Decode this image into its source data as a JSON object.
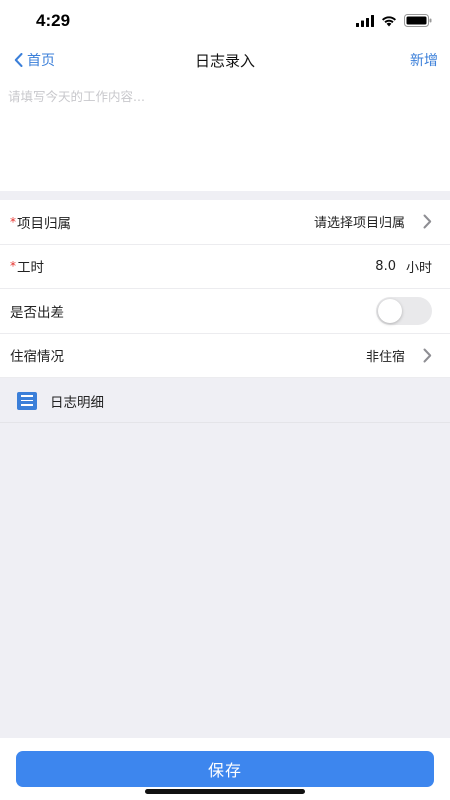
{
  "status_bar": {
    "time": "4:29"
  },
  "nav": {
    "back_label": "首页",
    "title": "日志录入",
    "action_label": "新增"
  },
  "content": {
    "placeholder": "请填写今天的工作内容...",
    "value": ""
  },
  "form": {
    "project": {
      "label": "项目归属",
      "value": "请选择项目归属",
      "required": true
    },
    "hours": {
      "label": "工时",
      "value": "8.0",
      "unit": "小时",
      "required": true
    },
    "business_trip": {
      "label": "是否出差",
      "enabled": false
    },
    "lodging": {
      "label": "住宿情况",
      "value": "非住宿"
    }
  },
  "details": {
    "title": "日志明细"
  },
  "footer": {
    "save_label": "保存"
  },
  "colors": {
    "accent": "#3b7fd9",
    "save_button": "#3d86ee",
    "required": "#e5322d",
    "background": "#efeff4"
  }
}
